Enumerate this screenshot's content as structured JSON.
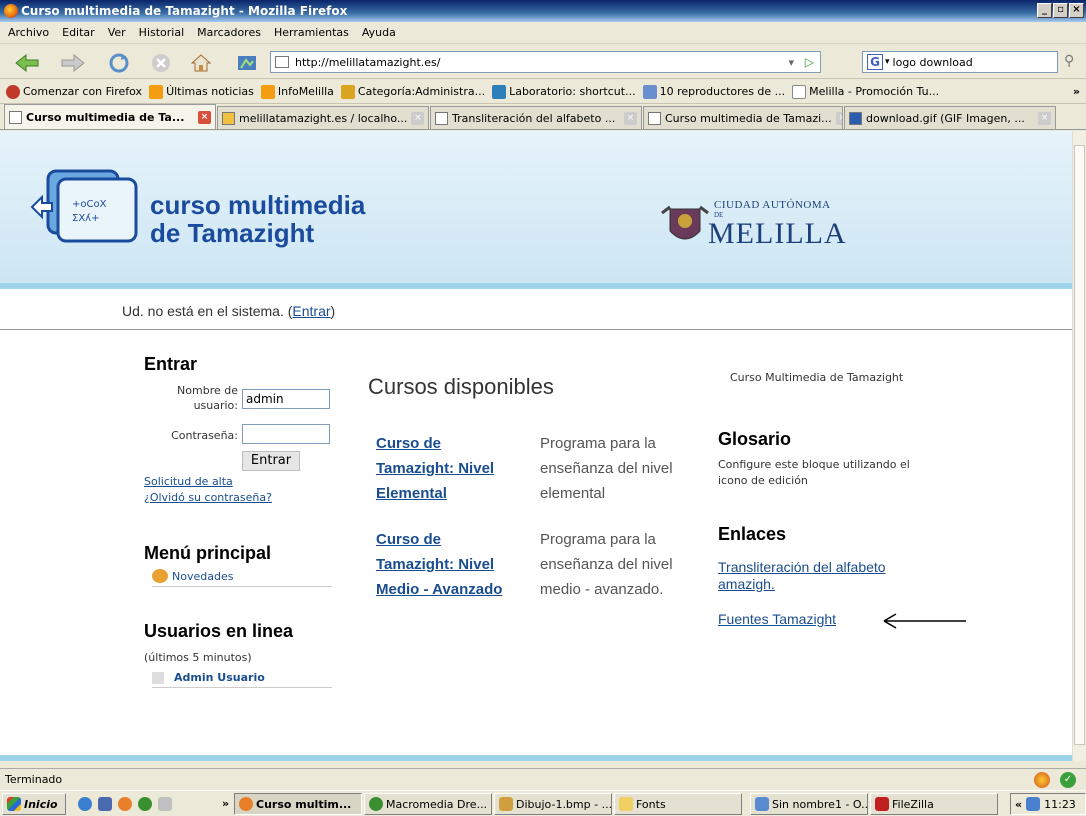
{
  "window": {
    "title": "Curso multimedia de Tamazight - Mozilla Firefox"
  },
  "menu": [
    "Archivo",
    "Editar",
    "Ver",
    "Historial",
    "Marcadores",
    "Herramientas",
    "Ayuda"
  ],
  "nav": {
    "url": "http://melillatamazight.es/",
    "search_value": "logo download"
  },
  "bookmarks": [
    "Comenzar con Firefox",
    "Últimas noticias",
    "InfoMelilla",
    "Categoría:Administra...",
    "Laboratorio: shortcut...",
    "10 reproductores de ...",
    "Melilla - Promoción Tu..."
  ],
  "tabs": [
    "Curso multimedia de Ta...",
    "melillatamazight.es / localho...",
    "Transliteración del alfabeto ...",
    "Curso multimedia de Tamazi...",
    "download.gif (GIF Imagen, ..."
  ],
  "page": {
    "logo_line1": "curso multimedia",
    "logo_line2": "de Tamazight",
    "ciudad": "CIUDAD AUTÓNOMA",
    "de": "DE",
    "melilla": "MELILLA",
    "not_logged": "Ud. no está en el sistema. (",
    "entrar_link": "Entrar",
    "close_paren": ")",
    "login": {
      "heading": "Entrar",
      "user_label_1": "Nombre de",
      "user_label_2": "usuario:",
      "user_value": "admin",
      "pass_label": "Contraseña:",
      "button": "Entrar",
      "signup": "Solicitud de alta",
      "forgot": "¿Olvidó su contraseña?"
    },
    "main_menu": {
      "heading": "Menú principal",
      "item": "Novedades"
    },
    "online": {
      "heading": "Usuarios en linea",
      "sub": "(últimos 5 minutos)",
      "user": "Admin Usuario"
    },
    "courses": {
      "heading": "Cursos disponibles",
      "items": [
        {
          "t1": "Curso de",
          "t2": "Tamazight: Nivel",
          "t3": "Elemental",
          "d1": "Programa para la",
          "d2": "enseñanza del nivel",
          "d3": "elemental"
        },
        {
          "t1": "Curso de",
          "t2": "Tamazight: Nivel",
          "t3": "Medio - Avanzado",
          "d1": "Programa para la",
          "d2": "enseñanza del nivel",
          "d3": "medio - avanzado."
        }
      ]
    },
    "right": {
      "site_name": "Curso Multimedia de Tamazight",
      "glosario": "Glosario",
      "glosario_text_1": "Configure este bloque utilizando el",
      "glosario_text_2": "icono de edición",
      "enlaces": "Enlaces",
      "link1_a": "Transliteración del alfabeto",
      "link1_b": "amazigh.",
      "link2": "Fuentes Tamazight"
    }
  },
  "status": "Terminado",
  "taskbar": {
    "start": "Inicio",
    "tasks": [
      "Curso multim...",
      "Macromedia Dre...",
      "Dibujo-1.bmp - ...",
      "Fonts",
      "Sin nombre1 - O...",
      "FileZilla"
    ],
    "clock": "11:23"
  }
}
